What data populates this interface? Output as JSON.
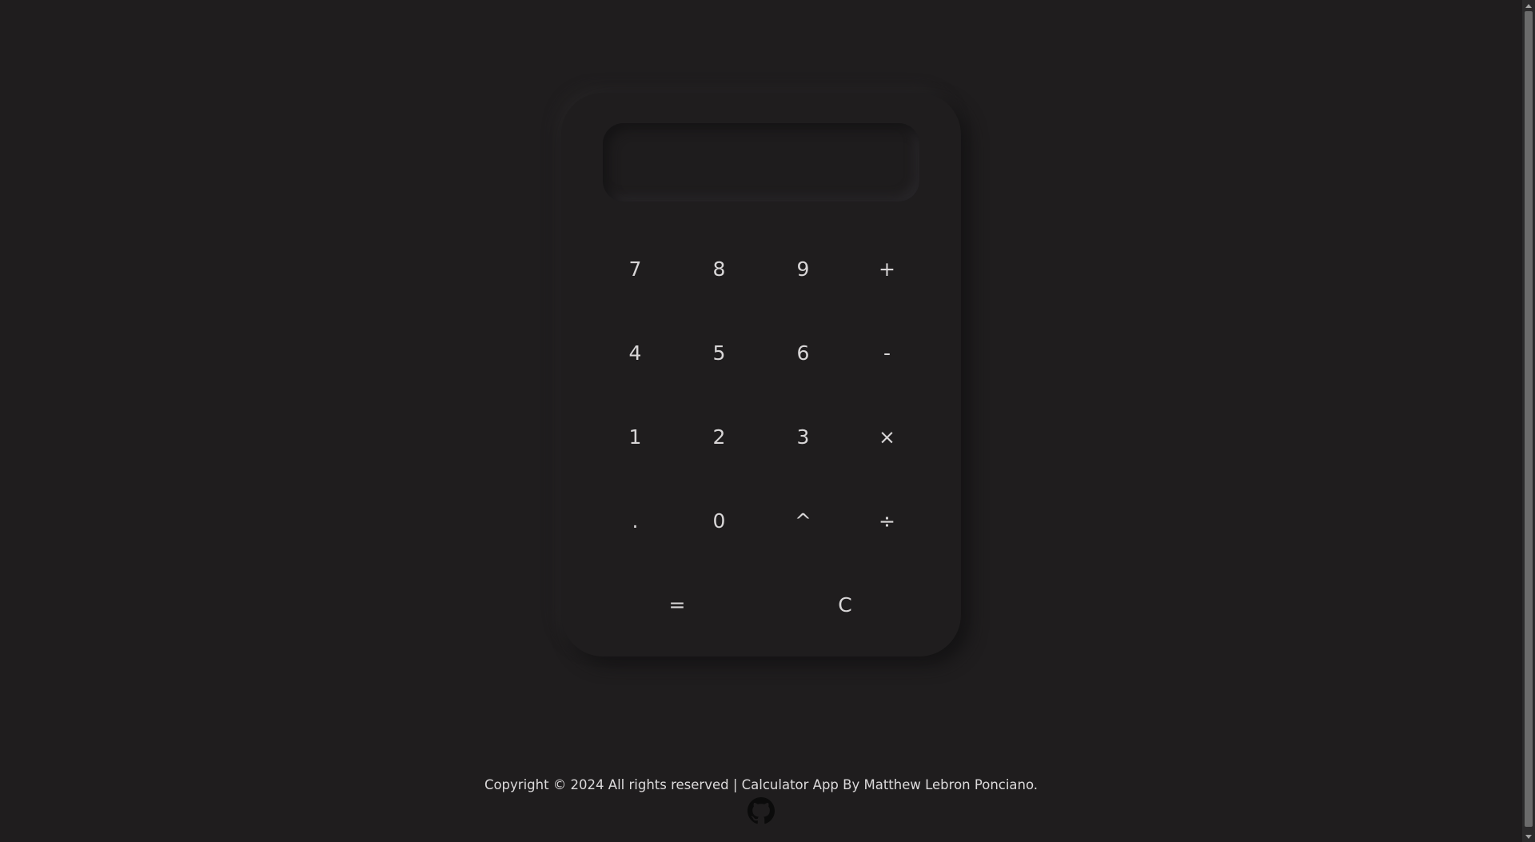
{
  "display": {
    "value": ""
  },
  "keys": [
    {
      "name": "key-7",
      "label": "7"
    },
    {
      "name": "key-8",
      "label": "8"
    },
    {
      "name": "key-9",
      "label": "9"
    },
    {
      "name": "key-add",
      "label": "+"
    },
    {
      "name": "key-4",
      "label": "4"
    },
    {
      "name": "key-5",
      "label": "5"
    },
    {
      "name": "key-6",
      "label": "6"
    },
    {
      "name": "key-subtract",
      "label": "-"
    },
    {
      "name": "key-1",
      "label": "1"
    },
    {
      "name": "key-2",
      "label": "2"
    },
    {
      "name": "key-3",
      "label": "3"
    },
    {
      "name": "key-multiply",
      "label": "×"
    },
    {
      "name": "key-decimal",
      "label": "."
    },
    {
      "name": "key-0",
      "label": "0"
    },
    {
      "name": "key-power",
      "label": "^"
    },
    {
      "name": "key-divide",
      "label": "÷"
    },
    {
      "name": "key-equals",
      "label": "="
    },
    {
      "name": "key-clear",
      "label": "C"
    }
  ],
  "footer": {
    "copyright": "Copyright © 2024 All rights reserved | Calculator App By Matthew Lebron Ponciano.",
    "github_icon": "github-icon"
  },
  "colors": {
    "background": "#1f1d1e",
    "text": "#d8d6d7"
  }
}
